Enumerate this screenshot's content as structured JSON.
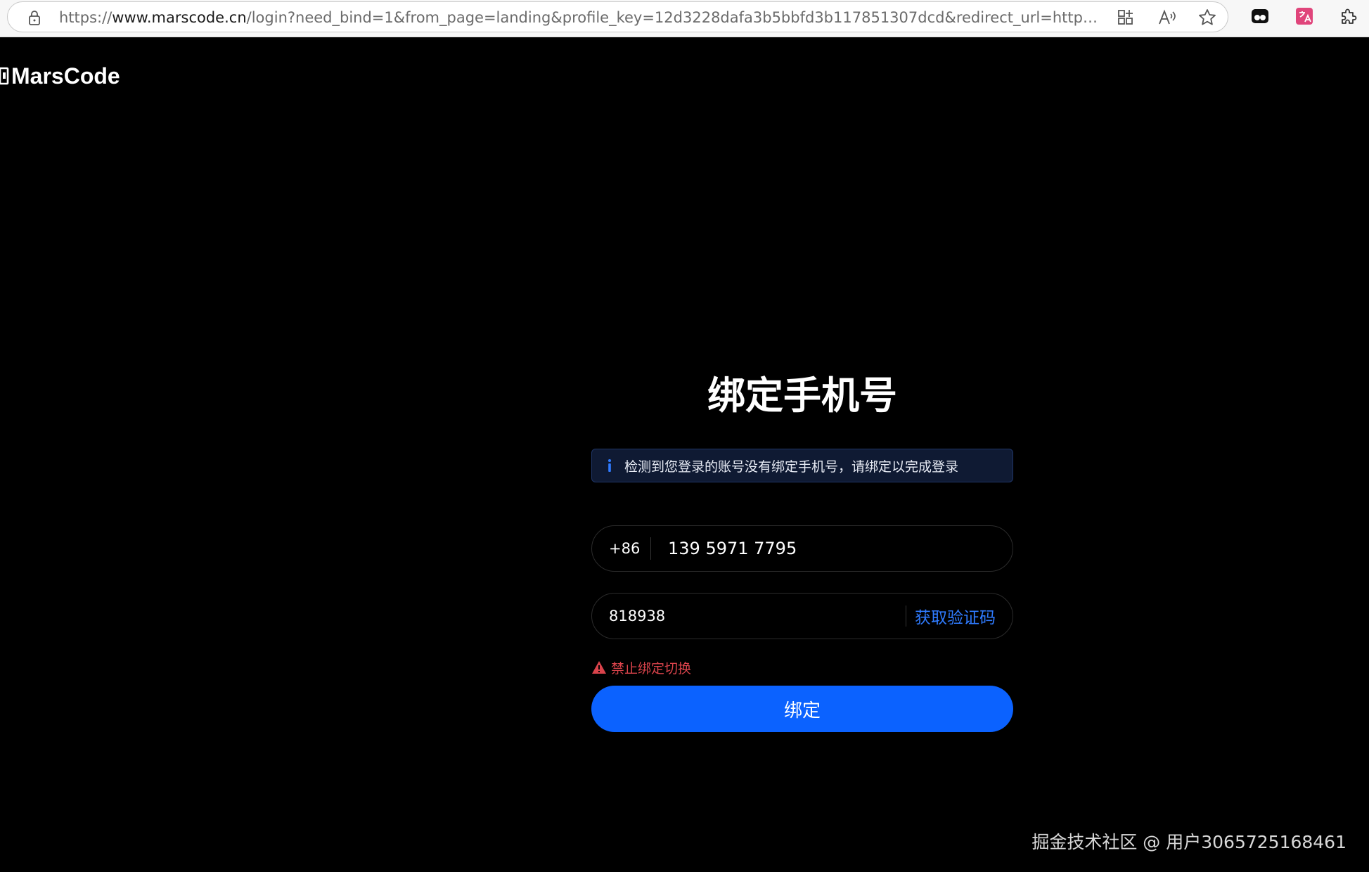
{
  "browser": {
    "url_protocol": "https://",
    "url_host": "www.marscode.cn",
    "url_rest": "/login?need_bind=1&from_page=landing&profile_key=12d3228dafa3b5bbfd3b117851307dcd&redirect_url=https%3A%2F%2Fww..."
  },
  "logo": {
    "text": "MarsCode"
  },
  "bind": {
    "title": "绑定手机号",
    "notice": "检测到您登录的账号没有绑定手机号，请绑定以完成登录",
    "country_code": "+86",
    "phone_value": "139 5971 7795",
    "code_value": "818938",
    "get_code_label": "获取验证码",
    "error_text": "禁止绑定切换",
    "submit_label": "绑定"
  },
  "watermark": "掘金技术社区 @ 用户3065725168461",
  "colors": {
    "accent": "#0b62ff",
    "link": "#2f7bff",
    "error": "#d9434b"
  }
}
